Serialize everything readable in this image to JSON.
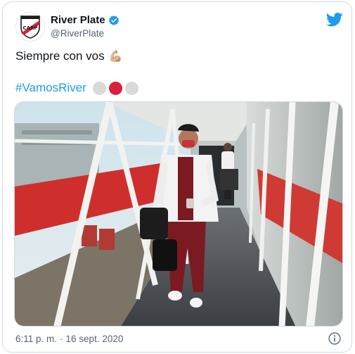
{
  "account": {
    "display_name": "River Plate",
    "handle": "@RiverPlate",
    "verified_icon": "verified-badge-icon",
    "avatar_icon": "river-plate-crest-icon"
  },
  "brand": {
    "twitter_icon": "twitter-bird-icon",
    "accent": "#1d9bf0"
  },
  "tweet": {
    "text": "Siempre con vos",
    "emoji": "💪🏼",
    "hashtag": "#VamosRiver",
    "circle_colors": [
      "#d9d9d9",
      "#d8203a",
      "#d9d9d9"
    ]
  },
  "media": {
    "alt": "Jugador caminando por la manga del aeropuerto"
  },
  "meta": {
    "time": "6:11 p. m.",
    "separator": "·",
    "date": "16 sept. 2020",
    "info_icon": "info-icon"
  }
}
